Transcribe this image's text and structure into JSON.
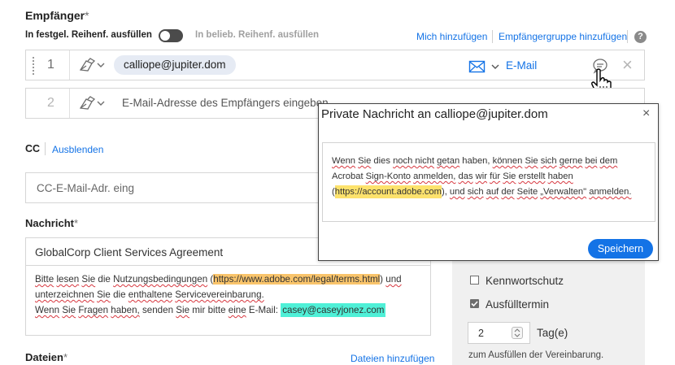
{
  "recipients": {
    "title": "Empfänger",
    "required_mark": "*",
    "order_fixed_label": "In festgel. Reihenf. ausfüllen",
    "order_any_label": "In belieb. Reihenf. ausfüllen",
    "add_me_link": "Mich hinzufügen",
    "add_group_link": "Empfängergruppe hinzufügen",
    "help_icon": "question-circle-icon",
    "rows": [
      {
        "index": "1",
        "email": "calliope@jupiter.dom",
        "delivery": "E-Mail"
      },
      {
        "index": "2",
        "placeholder": "E-Mail-Adresse des Empfängers eingeben"
      }
    ]
  },
  "cc": {
    "label": "CC",
    "hide_link": "Ausblenden",
    "placeholder": "CC-E-Mail-Adr. eing"
  },
  "message": {
    "title": "Nachricht",
    "required_mark": "*",
    "subject": "GlobalCorp Client Services Agreement",
    "body": {
      "p1": "Bitte",
      "p2": "lesen",
      "p3": "Sie",
      "p4": "die",
      "p5": "Nutzungsbedingungen",
      "p6": "(",
      "p7_link": "https://www.adobe.com/legal/terms.html",
      "p8": ")",
      "p9": "und",
      "p10": "unterzeichnen",
      "p11": "Sie",
      "p12": "die",
      "p13": "enthaltene",
      "p14": "Servicevereinbarung.",
      "p15": "Wenn",
      "p16": "Sie",
      "p17": "Fragen",
      "p18": "haben,",
      "p19": "senden",
      "p20": "Sie",
      "p21": "mir",
      "p22": "bitte",
      "p23": "eine",
      "p24": "E-Mail:",
      "p25_email": "casey@caseyjonez.com"
    }
  },
  "files": {
    "title": "Dateien",
    "required_mark": "*",
    "add_link": "Dateien hinzufügen"
  },
  "options": {
    "password_label": "Kennwortschutz",
    "password_checked": false,
    "deadline_label": "Ausfülltermin",
    "deadline_checked": true,
    "days_value": "2",
    "days_unit": "Tag(e)",
    "deadline_hint": "zum Ausfüllen der Vereinbarung."
  },
  "private_dialog": {
    "title": "Private Nachricht an calliope@jupiter.dom",
    "close_glyph": "×",
    "text": {
      "t1": "Wenn",
      "t2": "Sie",
      "t3": "dies",
      "t4": "noch nicht",
      "t5": "getan",
      "t6": "haben,",
      "t7": "können",
      "t8": "Sie",
      "t9": "sich",
      "t10": "gerne",
      "t11": "bei",
      "t12": "dem",
      "t13": "Acrobat",
      "t14": "Sign-Konto",
      "t15": "anmelden,",
      "t16": "das",
      "t17": "wir",
      "t18": "für",
      "t19": "Sie",
      "t20": "erstellt",
      "t21": "haben",
      "t22": "(",
      "t23_link": "https://account.adobe.com",
      "t24": "),",
      "t25": "und",
      "t26": "sich",
      "t27": "auf",
      "t28": "der",
      "t29": "Seite",
      "t30": "„Verwalten\"",
      "t31": "anmelden."
    },
    "save_button": "Speichern"
  },
  "colors": {
    "accent": "#1473e6",
    "highlight_yellow": "#fde26c",
    "highlight_orange": "#f9c46b",
    "highlight_cyan": "#4ff0d7",
    "spell_underline": "#d7373f"
  }
}
